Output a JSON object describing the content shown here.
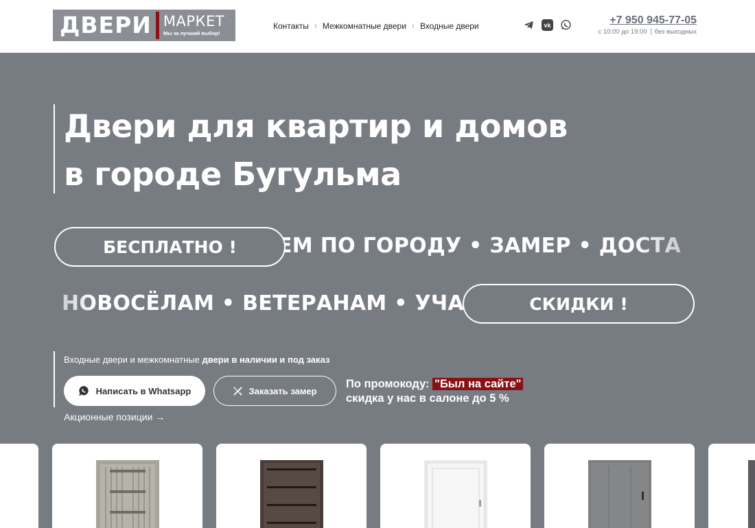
{
  "header": {
    "logo": {
      "main": "ДВЕРИ",
      "sub1": "МАРКЕТ",
      "sub2": "Мы за лучший выбор!"
    },
    "nav": [
      {
        "label": "Контакты"
      },
      {
        "label": "Межкомнатные двери"
      },
      {
        "label": "Входные двери"
      }
    ],
    "social_icons": [
      "telegram-icon",
      "vk-icon",
      "whatsapp-icon"
    ],
    "phone": "+7 950 945-77-05",
    "hours": "с 10:00 до 19:00",
    "days": "без выходных"
  },
  "hero": {
    "title_line1": "Двери для квартир и домов",
    "title_line2": "в городе Бугульма",
    "marquee1": "ЕМ ПО ГОРОДУ  •  ЗАМЕР  •  ДОСТА",
    "marquee1_pill": "БЕСПЛАТНО !",
    "marquee2": "НОВОСЁЛАМ  •  ВЕТЕРАНАМ  •  УЧА",
    "marquee2_pill": "СКИДКИ !",
    "subtitle_plain": "Входные двери и межкомнатные ",
    "subtitle_bold": "двери в наличии и под заказ",
    "btn_whatsapp": "Написать в Whatsapp",
    "btn_zamer": "Заказать замер",
    "promo_prefix": "По промокоду: ",
    "promo_code": "\"Был на сайте\"",
    "promo_suffix": "скидка у нас в салоне до 5 %",
    "actions_link": "Акционные позиции →"
  },
  "colors": {
    "hero_bg": "#777b82",
    "accent": "#8a1016",
    "logo_bg": "#8b8f95"
  }
}
